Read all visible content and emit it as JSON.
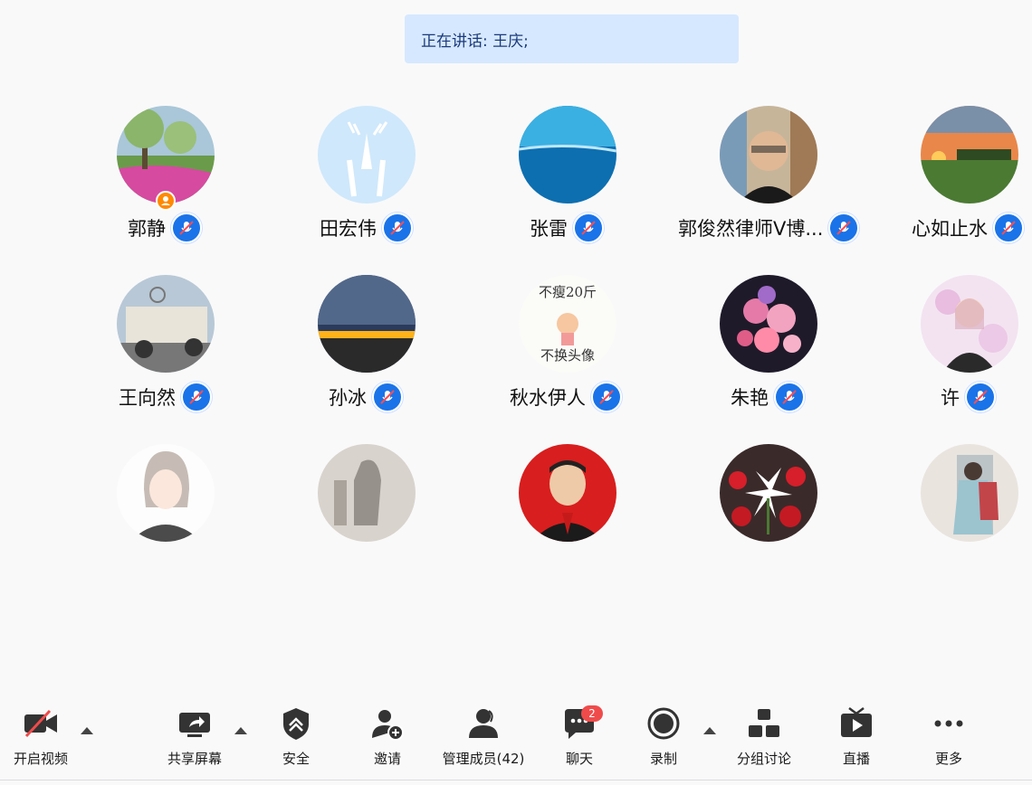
{
  "speaking_banner": {
    "text": "正在讲话: 王庆;"
  },
  "participants": [
    {
      "name": "郭静",
      "muted": true,
      "host": true
    },
    {
      "name": "田宏伟",
      "muted": true
    },
    {
      "name": "张雷",
      "muted": true
    },
    {
      "name": "郭俊然律师V博...",
      "muted": true
    },
    {
      "name": "心如止水",
      "muted": true
    },
    {
      "name": "王向然",
      "muted": true
    },
    {
      "name": "孙冰",
      "muted": true
    },
    {
      "name": "秋水伊人",
      "muted": true,
      "avatar_text": [
        "不瘦20斤",
        "不换头像"
      ]
    },
    {
      "name": "朱艳",
      "muted": true
    },
    {
      "name": "许",
      "muted": true
    },
    {
      "name": "",
      "muted": false
    },
    {
      "name": "",
      "muted": false
    },
    {
      "name": "",
      "muted": false
    },
    {
      "name": "",
      "muted": false
    },
    {
      "name": "",
      "muted": false
    }
  ],
  "toolbar": {
    "video": "开启视频",
    "share": "共享屏幕",
    "security": "安全",
    "invite": "邀请",
    "members": "管理成员(42)",
    "chat": "聊天",
    "chat_badge": "2",
    "record": "录制",
    "breakout": "分组讨论",
    "live": "直播",
    "more": "更多"
  },
  "colors": {
    "accent": "#1a73e8",
    "banner_bg": "#d6e8ff",
    "badge": "#f04b4b",
    "host": "#ff8a00"
  }
}
